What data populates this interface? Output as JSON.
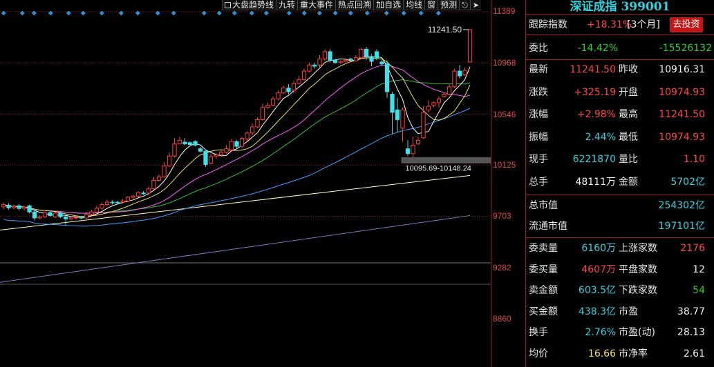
{
  "toolbar": {
    "items": [
      "大盘趋势线",
      "九转",
      "重大事件",
      "热点回溯",
      "加自选",
      "均线",
      "窗",
      "预测"
    ],
    "icons": [
      "lock-icon",
      "export-icon"
    ]
  },
  "chart": {
    "y_ticks": [
      "11389",
      "10968",
      "10546",
      "10125",
      "9703",
      "9282",
      "8860"
    ],
    "high_label": "11241.50",
    "range_label": "10095.69-10148.24",
    "colors": {
      "up": "#ff4040",
      "down": "#40e0e8",
      "ma5": "#ffffff",
      "ma10": "#f0e060",
      "ma20": "#ff60ff",
      "ma30": "#30c030",
      "ma60": "#40a0ff",
      "ma120": "#ffffc0",
      "ma250": "#7080c0"
    }
  },
  "panel": {
    "title": "深证成指 399001",
    "track_label": "跟踪指数",
    "track_value": "+18.31%",
    "track_period": "[3个月]",
    "invest_button": "去投资",
    "weibi_label": "委比",
    "weibi_pct": "-14.42%",
    "weibi_diff": "-15526132",
    "rows_a": [
      {
        "l1": "最新",
        "v1": "11241.50",
        "c1": "red",
        "l2": "昨收",
        "v2": "10916.31",
        "c2": "white"
      },
      {
        "l1": "涨跌",
        "v1": "+325.19",
        "c1": "red",
        "l2": "开盘",
        "v2": "10974.93",
        "c2": "red"
      },
      {
        "l1": "涨幅",
        "v1": "+2.98%",
        "c1": "red",
        "l2": "最高",
        "v2": "11241.50",
        "c2": "red"
      },
      {
        "l1": "振幅",
        "v1": "2.44%",
        "c1": "cyan",
        "l2": "最低",
        "v2": "10974.93",
        "c2": "red"
      },
      {
        "l1": "现手",
        "v1": "6221870",
        "c1": "cyan",
        "l2": "量比",
        "v2": "1.10",
        "c2": "red"
      },
      {
        "l1": "总手",
        "v1": "48111万",
        "c1": "white",
        "l2": "金额",
        "v2": "5702亿",
        "c2": "cyan"
      }
    ],
    "mkt_cap_label": "总市值",
    "mkt_cap": "254302亿",
    "float_cap_label": "流通市值",
    "float_cap": "197101亿",
    "rows_b": [
      {
        "l1": "委卖量",
        "v1": "6160万",
        "c1": "cyan",
        "l2": "上涨家数",
        "v2": "2176",
        "c2": "red"
      },
      {
        "l1": "委买量",
        "v1": "4607万",
        "c1": "red",
        "l2": "平盘家数",
        "v2": "12",
        "c2": "white"
      },
      {
        "l1": "卖金额",
        "v1": "603.5亿",
        "c1": "cyan",
        "l2": "下跌家数",
        "v2": "54",
        "c2": "green"
      },
      {
        "l1": "买金额",
        "v1": "438.3亿",
        "c1": "cyan",
        "l2": "市盈",
        "v2": "38.77",
        "c2": "white"
      },
      {
        "l1": "换手",
        "v1": "2.76%",
        "c1": "cyan",
        "l2": "市盈(动)",
        "v2": "28.13",
        "c2": "white"
      },
      {
        "l1": "均价",
        "v1": "16.66",
        "c1": "yellow",
        "l2": "市净率",
        "v2": "2.61",
        "c2": "white"
      }
    ]
  },
  "chart_data": {
    "type": "candlestick",
    "ylim": [
      8860,
      11389
    ],
    "candles": [
      [
        9782,
        9800,
        9760,
        9818
      ],
      [
        9795,
        9774,
        9760,
        9810
      ],
      [
        9775,
        9785,
        9762,
        9800
      ],
      [
        9790,
        9768,
        9755,
        9805
      ],
      [
        9770,
        9780,
        9752,
        9790
      ],
      [
        9790,
        9740,
        9728,
        9800
      ],
      [
        9740,
        9690,
        9670,
        9755
      ],
      [
        9690,
        9700,
        9680,
        9710
      ],
      [
        9700,
        9735,
        9690,
        9745
      ],
      [
        9735,
        9710,
        9700,
        9745
      ],
      [
        9700,
        9730,
        9690,
        9740
      ],
      [
        9730,
        9700,
        9690,
        9740
      ],
      [
        9698,
        9682,
        9630,
        9710
      ],
      [
        9682,
        9690,
        9672,
        9705
      ],
      [
        9690,
        9695,
        9675,
        9705
      ],
      [
        9695,
        9690,
        9680,
        9700
      ],
      [
        9690,
        9720,
        9685,
        9740
      ],
      [
        9720,
        9740,
        9710,
        9760
      ],
      [
        9740,
        9770,
        9730,
        9790
      ],
      [
        9770,
        9800,
        9760,
        9820
      ],
      [
        9800,
        9820,
        9790,
        9840
      ],
      [
        9820,
        9818,
        9800,
        9835
      ],
      [
        9820,
        9815,
        9800,
        9830
      ],
      [
        9820,
        9830,
        9810,
        9845
      ],
      [
        9830,
        9860,
        9820,
        9870
      ],
      [
        9860,
        9870,
        9850,
        9880
      ],
      [
        9870,
        9900,
        9860,
        9910
      ],
      [
        9895,
        9890,
        9880,
        9910
      ],
      [
        9895,
        9930,
        9880,
        9950
      ],
      [
        9930,
        10000,
        9920,
        10030
      ],
      [
        10000,
        10030,
        9990,
        10050
      ],
      [
        10030,
        10120,
        10020,
        10150
      ],
      [
        10120,
        10200,
        10110,
        10230
      ],
      [
        10200,
        10300,
        10190,
        10350
      ],
      [
        10300,
        10330,
        10300,
        10360
      ],
      [
        10315,
        10300,
        10290,
        10350
      ],
      [
        10310,
        10295,
        10280,
        10320
      ],
      [
        10320,
        10290,
        10280,
        10330
      ],
      [
        10260,
        10240,
        10230,
        10275
      ],
      [
        10240,
        10130,
        10110,
        10245
      ],
      [
        10140,
        10195,
        10130,
        10220
      ],
      [
        10200,
        10210,
        10180,
        10225
      ],
      [
        10210,
        10230,
        10200,
        10250
      ],
      [
        10230,
        10260,
        10220,
        10290
      ],
      [
        10250,
        10320,
        10240,
        10340
      ],
      [
        10320,
        10280,
        10260,
        10330
      ],
      [
        10280,
        10345,
        10270,
        10360
      ],
      [
        10340,
        10390,
        10320,
        10400
      ],
      [
        10390,
        10440,
        10370,
        10470
      ],
      [
        10440,
        10500,
        10430,
        10520
      ],
      [
        10500,
        10600,
        10490,
        10630
      ],
      [
        10600,
        10620,
        10590,
        10640
      ],
      [
        10620,
        10670,
        10610,
        10690
      ],
      [
        10670,
        10720,
        10660,
        10740
      ],
      [
        10720,
        10760,
        10710,
        10780
      ],
      [
        10760,
        10730,
        10710,
        10790
      ],
      [
        10740,
        10800,
        10720,
        10820
      ],
      [
        10800,
        10830,
        10790,
        10860
      ],
      [
        10830,
        10900,
        10820,
        10920
      ],
      [
        10900,
        10950,
        10890,
        10970
      ],
      [
        10950,
        10940,
        10920,
        10970
      ],
      [
        10950,
        11000,
        10930,
        11030
      ],
      [
        11000,
        11060,
        10980,
        11080
      ],
      [
        11060,
        10990,
        10970,
        11080
      ],
      [
        10990,
        10970,
        10960,
        11000
      ],
      [
        10970,
        10980,
        10960,
        10990
      ],
      [
        10980,
        10990,
        10970,
        11000
      ],
      [
        11000,
        10995,
        10985,
        11010
      ],
      [
        10985,
        11010,
        10980,
        11030
      ],
      [
        11010,
        11080,
        11000,
        11090
      ],
      [
        11080,
        11020,
        10990,
        11100
      ],
      [
        11020,
        10980,
        10940,
        11040
      ],
      [
        11060,
        11010,
        10990,
        11080
      ],
      [
        10975,
        10960,
        10940,
        10990
      ],
      [
        10960,
        10730,
        10680,
        10990
      ],
      [
        10710,
        10560,
        10380,
        10730
      ],
      [
        10580,
        10500,
        10400,
        10680
      ],
      [
        10430,
        10580,
        10320,
        10600
      ],
      [
        10260,
        10220,
        10200,
        10330
      ],
      [
        10220,
        10290,
        10180,
        10360
      ],
      [
        10300,
        10330,
        10290,
        10360
      ],
      [
        10350,
        10560,
        10340,
        10610
      ],
      [
        10580,
        10610,
        10560,
        10660
      ],
      [
        10620,
        10640,
        10600,
        10650
      ],
      [
        10640,
        10670,
        10600,
        10690
      ],
      [
        10690,
        10710,
        10680,
        10720
      ],
      [
        10710,
        10770,
        10700,
        10790
      ],
      [
        10770,
        10900,
        10760,
        10920
      ],
      [
        10900,
        10860,
        10840,
        10950
      ],
      [
        10870,
        10905,
        10860,
        10930
      ],
      [
        10974.93,
        11241.5,
        10974.93,
        11241.5
      ]
    ]
  }
}
